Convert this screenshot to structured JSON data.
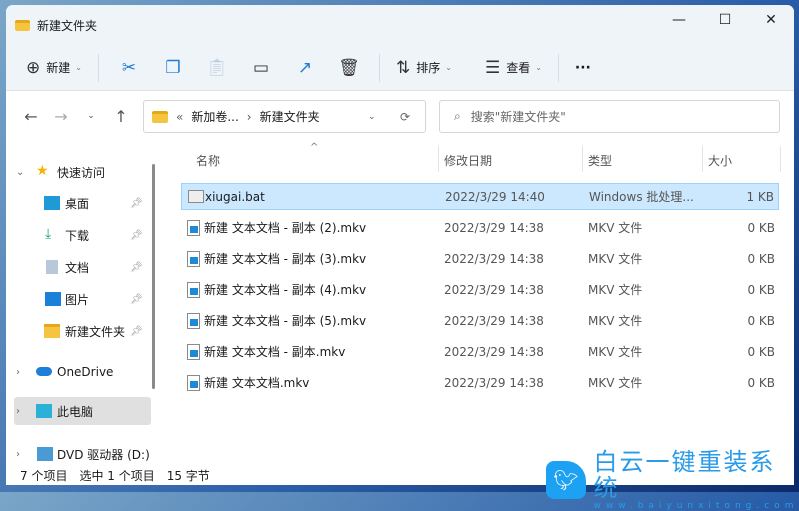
{
  "window": {
    "title": "新建文件夹",
    "minimize": "—",
    "maximize": "☐",
    "close": "✕"
  },
  "toolbar": {
    "new_label": "新建",
    "sort_label": "排序",
    "view_label": "查看",
    "more": "···"
  },
  "nav": {
    "breadcrumb_prefix": "«",
    "crumbs": [
      "新加卷...",
      "新建文件夹"
    ],
    "search_placeholder": "搜索\"新建文件夹\""
  },
  "sidebar": {
    "items": [
      {
        "label": "快速访问"
      },
      {
        "label": "桌面"
      },
      {
        "label": "下载"
      },
      {
        "label": "文档"
      },
      {
        "label": "图片"
      },
      {
        "label": "新建文件夹"
      },
      {
        "label": "OneDrive"
      },
      {
        "label": "此电脑"
      },
      {
        "label": "DVD 驱动器 (D:)"
      }
    ]
  },
  "columns": [
    "名称",
    "修改日期",
    "类型",
    "大小"
  ],
  "files": [
    {
      "name": "xiugai.bat",
      "date": "2022/3/29 14:40",
      "type": "Windows 批处理...",
      "size": "1 KB"
    },
    {
      "name": "新建 文本文档 - 副本 (2).mkv",
      "date": "2022/3/29 14:38",
      "type": "MKV 文件",
      "size": "0 KB"
    },
    {
      "name": "新建 文本文档 - 副本 (3).mkv",
      "date": "2022/3/29 14:38",
      "type": "MKV 文件",
      "size": "0 KB"
    },
    {
      "name": "新建 文本文档 - 副本 (4).mkv",
      "date": "2022/3/29 14:38",
      "type": "MKV 文件",
      "size": "0 KB"
    },
    {
      "name": "新建 文本文档 - 副本 (5).mkv",
      "date": "2022/3/29 14:38",
      "type": "MKV 文件",
      "size": "0 KB"
    },
    {
      "name": "新建 文本文档 - 副本.mkv",
      "date": "2022/3/29 14:38",
      "type": "MKV 文件",
      "size": "0 KB"
    },
    {
      "name": "新建 文本文档.mkv",
      "date": "2022/3/29 14:38",
      "type": "MKV 文件",
      "size": "0 KB"
    }
  ],
  "status": {
    "count": "7 个项目",
    "selected": "选中 1 个项目",
    "size": "15 字节"
  },
  "watermark": {
    "title": "白云一键重装系统",
    "url": "www.baiyunxitong.com"
  }
}
